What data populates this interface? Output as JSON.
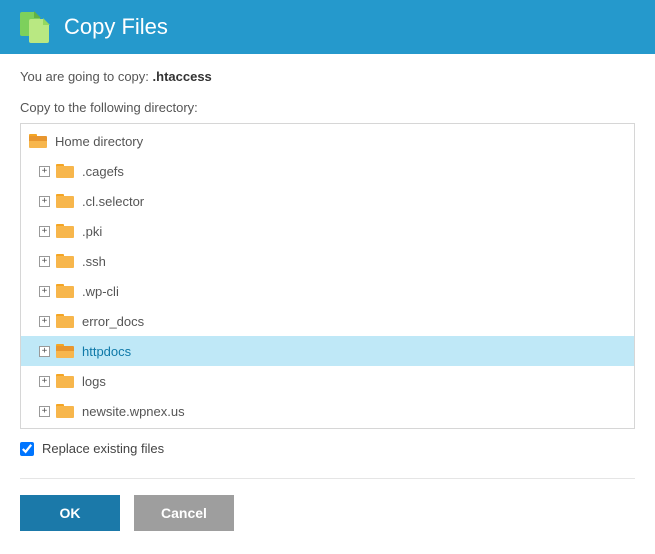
{
  "header": {
    "title": "Copy Files"
  },
  "intro": {
    "prefix": "You are going to copy: ",
    "filename": ".htaccess"
  },
  "subhead": "Copy to the following directory:",
  "tree": {
    "root": {
      "label": "Home directory"
    },
    "children": [
      {
        "label": ".cagefs",
        "selected": false
      },
      {
        "label": ".cl.selector",
        "selected": false
      },
      {
        "label": ".pki",
        "selected": false
      },
      {
        "label": ".ssh",
        "selected": false
      },
      {
        "label": ".wp-cli",
        "selected": false
      },
      {
        "label": "error_docs",
        "selected": false
      },
      {
        "label": "httpdocs",
        "selected": true
      },
      {
        "label": "logs",
        "selected": false
      },
      {
        "label": "newsite.wpnex.us",
        "selected": false
      }
    ]
  },
  "replace": {
    "label": "Replace existing files",
    "checked": true
  },
  "buttons": {
    "ok": "OK",
    "cancel": "Cancel"
  }
}
